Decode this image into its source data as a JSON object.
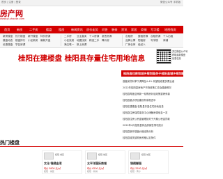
{
  "topbar": {
    "left": "首页 | 注册 | 登录",
    "right": "微信公众号  手机版"
  },
  "logo": {
    "text": "房产网",
    "url": "www.gl.uhouse.com"
  },
  "nav": [
    "首页",
    "新房",
    "二手房",
    "楼盘",
    "租房",
    "新闻资讯",
    "房价走势",
    "问答",
    "装修",
    "资讯",
    "家居",
    "商铺",
    "写字楼",
    "地图找房"
  ],
  "subnav": [
    [
      "新房楼盘",
      "热门楼盘",
      "新开楼盘",
      "特价房源",
      "楼盘动态",
      "楼盘排行",
      "小区新房",
      "最新开盘",
      "优惠楼盘",
      "学区房源"
    ],
    [
      "二手房",
      "业主直卖",
      "个人房源",
      "急售房源",
      "小区找房",
      "地图找房",
      "精选二手",
      "降价房",
      "满五唯一",
      "新上房源"
    ],
    [
      "出租房",
      "整租房源",
      "合租房源",
      "个人出租",
      "品牌公寓",
      "短租房",
      "写字楼",
      "商铺",
      "厂房仓库",
      "经纪人"
    ]
  ],
  "headline": "桂阳在建楼盘 桂阳县存量住宅用地信息",
  "promo": [
    "关注微信公众号",
    "获取最新楼盘",
    "优惠信息"
  ],
  "news_header": "桂阳县住房和城乡规划局关于桂阳县城乡规划编制",
  "news": [
    "首套房贷利率下调降至4.4% 有望吸收更多置业者",
    "2022年桂阳县房地产市场政策汇总及楼盘情况",
    "桂阳县再度迎来新一轮购房补贴政策重磅来袭",
    "桂阳县重点项目建设有序推进中",
    "桂阳在建楼盘 桂阳县存量住宅用地信息",
    "桂阳县住房保障事务中心储备房源信息一览",
    "桂阳县住房公积金管理部关于开展公积金贷款",
    "2022年4月桂阳县商品房销售情况统计",
    "桂阳县新开楼盘价格走势分析",
    "桂阳县城关镇购房资格认定条件"
  ],
  "section_title": "热门楼盘",
  "cards": [
    {
      "cap": "桂阳·城区",
      "name": "文化·锦绣金湾",
      "price": "均价 5800 元/㎡",
      "loc": "桂阳 · 城区"
    },
    {
      "cap": "桂阳·城区",
      "name": "太平洋国际商城",
      "price": "均价 6200 元/㎡",
      "loc": "桂阳 · 新城"
    },
    {
      "cap": "桂阳·城区",
      "name": "锦绣御园",
      "price": "均价 5200 元/㎡",
      "loc": "桂阳 · 黄沙"
    }
  ],
  "colors": {
    "brand": "#d40000",
    "bg": "#ffffff"
  }
}
